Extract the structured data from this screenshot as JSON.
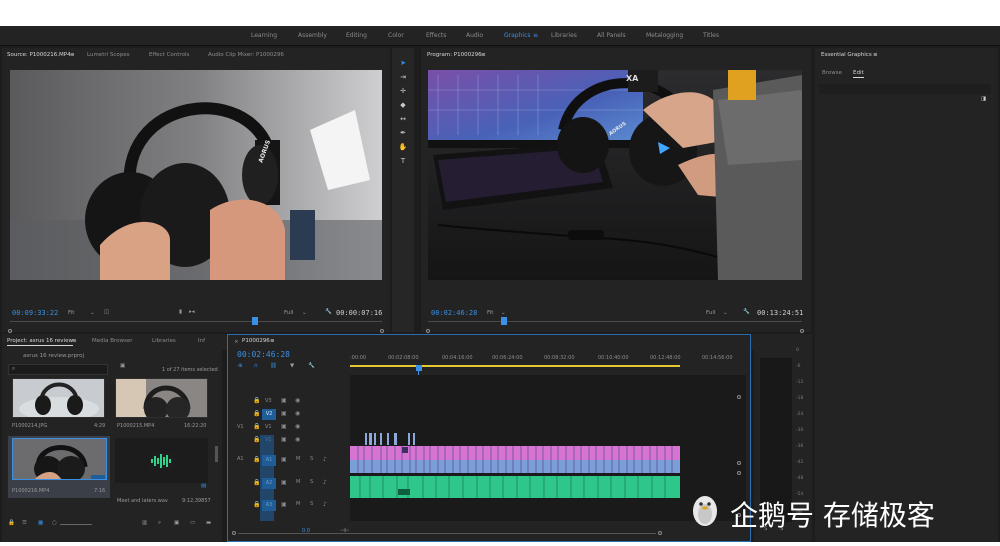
{
  "workspaces": {
    "items": [
      "Learning",
      "Assembly",
      "Editing",
      "Color",
      "Effects",
      "Audio",
      "Graphics",
      "Libraries",
      "All Panels",
      "Metalogging",
      "Titles"
    ],
    "active": "Graphics",
    "menu_glyph": "≡"
  },
  "source_panel": {
    "tabs": [
      "Source: P1000216.MP4",
      "Lumetri Scopes",
      "Effect Controls",
      "Audio Clip Mixer: P1000296"
    ],
    "menu_glyph": "≡",
    "timecode": "00:09:33:22",
    "fit": "Fit",
    "resolution": "Full",
    "duration": "00:00:07:16",
    "logo_text": "AORUS"
  },
  "program_panel": {
    "title": "Program: P1000296",
    "menu_glyph": "≡",
    "timecode": "00:02:46:28",
    "fit": "Fit",
    "resolution": "Full",
    "duration": "00:13:24:51",
    "logo_text": "AORUS"
  },
  "essential_graphics": {
    "title": "Essential Graphics",
    "menu_glyph": "≡",
    "tabs": [
      "Browse",
      "Edit"
    ],
    "active_tab": "Edit"
  },
  "project_panel": {
    "tabs": [
      "Project: asrus 16 review",
      "Media Browser",
      "Libraries",
      "Inf"
    ],
    "menu_glyph": "≡",
    "file_name": "asrus 16 review.prproj",
    "items_count": "1 of 27 items selected",
    "items": [
      {
        "name": "P1000214.JPG",
        "duration": "4:29"
      },
      {
        "name": "P1000215.MP4",
        "duration": "16:22:20"
      },
      {
        "name": "P1000216.MP4",
        "duration": "7:16"
      },
      {
        "name": "Meet and laters.wav",
        "duration": "9:12,39857"
      }
    ]
  },
  "timeline": {
    "sequence": "P1000296",
    "menu_glyph": "≡",
    "timecode": "00:02:46:28",
    "ruler": [
      ":00:00",
      "00:02:08:00",
      "00:04:16:00",
      "00:06:24:00",
      "00:08:32:00",
      "00:10:40:00",
      "00:12:48:00",
      "00:14:56:00"
    ],
    "video_tracks": [
      "V3",
      "V2",
      "V1"
    ],
    "audio_tracks": [
      "A1",
      "A2",
      "A3"
    ],
    "source_v": "V1",
    "source_a": "A1",
    "btn_m": "M",
    "btn_s": "S",
    "bottom_label": "0.0"
  },
  "meter": {
    "labels": [
      "0",
      "-6",
      "-12",
      "-18",
      "-24",
      "-30",
      "-36",
      "-42",
      "-48",
      "-54",
      "dB"
    ],
    "solo_s": "S",
    "solo_s2": "S"
  },
  "watermark": {
    "text": "企鹅号 存储极客"
  }
}
